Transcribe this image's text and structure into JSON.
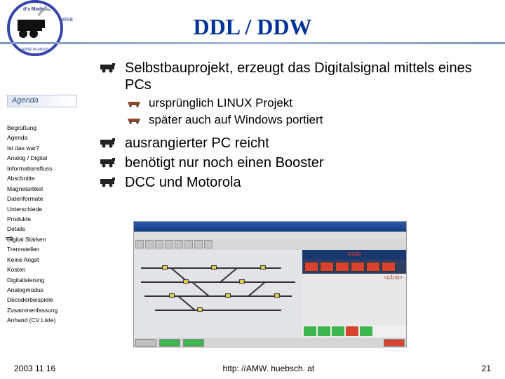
{
  "title": "DDL / DDW",
  "agenda_label": "Agenda",
  "sidebar": {
    "items": [
      "Begrüßung",
      "Agenda",
      "Ist das war?",
      "Analog / Digital",
      "Informationsfluss",
      "Abschnitte",
      "Magnetartikel",
      "Datenformate",
      "Unterschiede",
      "Produkte",
      "Details",
      "Digital Stärken",
      "Trennstellen",
      "Keine Angst",
      "Kosten",
      "Digitalisierung",
      "Analogmodus",
      "Decoderbeispiele",
      "Zusammenfassung",
      "Anhand (CV Liste)"
    ],
    "current_index": 9
  },
  "bullets": [
    {
      "text": "Selbstbauprojekt, erzeugt das Digitalsignal mittels eines PCs",
      "level": 0
    },
    {
      "text": "ursprünglich LINUX Projekt",
      "level": 1
    },
    {
      "text": "später auch auf Windows portiert",
      "level": 1
    },
    {
      "text": "ausrangierter PC reicht",
      "level": 0
    },
    {
      "text": "benötigt nur noch einen Booster",
      "level": 0
    },
    {
      "text": "DCC und Motorola",
      "level": 0
    }
  ],
  "screenshot": {
    "panel_title": "V100",
    "panel_side_label": "<o1rst>"
  },
  "footer": {
    "date": "2003 11 16",
    "url": "http: //AMW. huebsch. at",
    "page": "21"
  }
}
